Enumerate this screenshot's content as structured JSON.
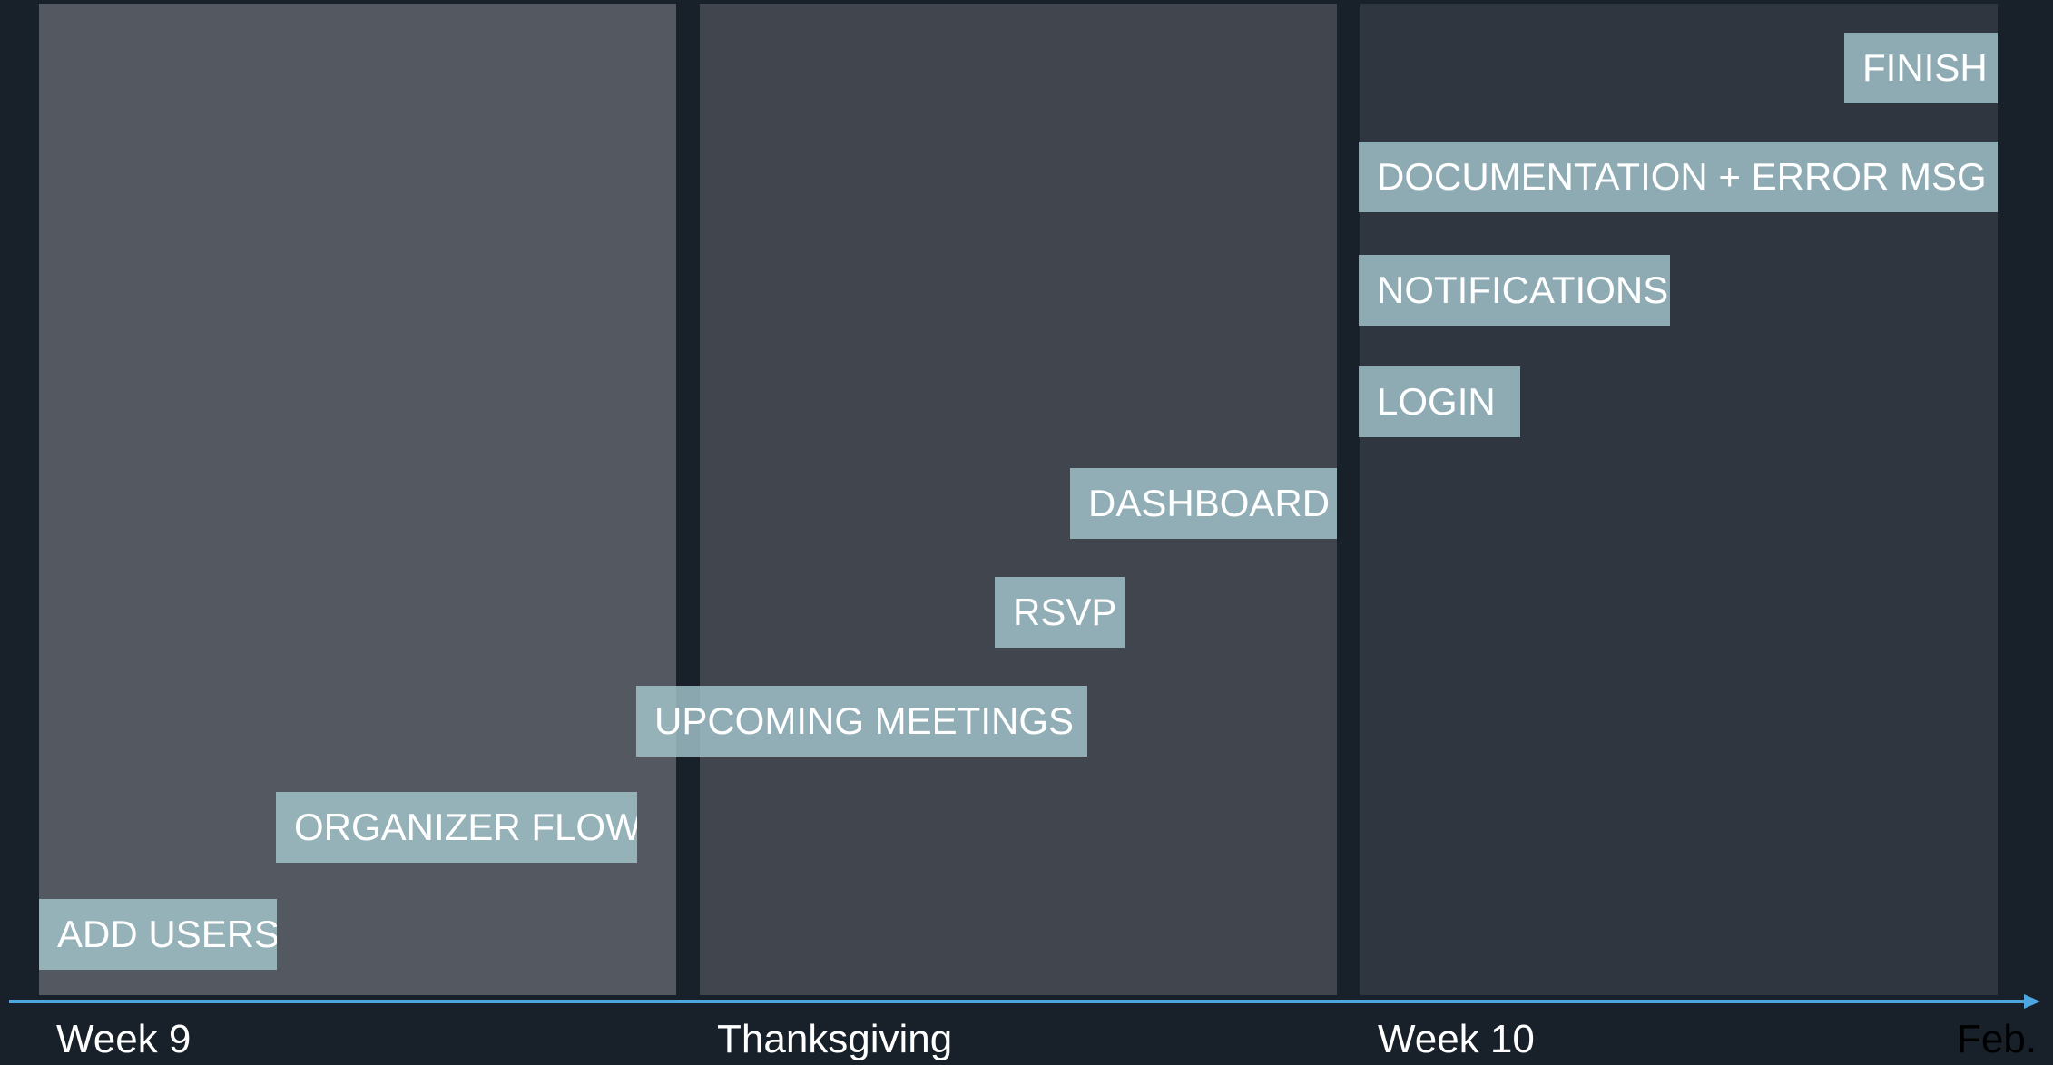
{
  "tasks": [
    {
      "label": "ADD USERS"
    },
    {
      "label": "ORGANIZER FLOW"
    },
    {
      "label": "UPCOMING MEETINGS"
    },
    {
      "label": "RSVP"
    },
    {
      "label": "DASHBOARD"
    },
    {
      "label": "LOGIN"
    },
    {
      "label": "NOTIFICATIONS"
    },
    {
      "label": "DOCUMENTATION + ERROR MSG"
    },
    {
      "label": "FINISH"
    }
  ],
  "timeline": {
    "labels": [
      "Week 9",
      "Thanksgiving",
      "Week 10",
      "Feb."
    ]
  },
  "colors": {
    "background": "#18202a",
    "panel_week9": "#545860",
    "panel_thanksgiving": "#41454d",
    "panel_week10": "#30363f",
    "task_bar": "#a4c6cd",
    "axis": "#4ea6e0"
  }
}
